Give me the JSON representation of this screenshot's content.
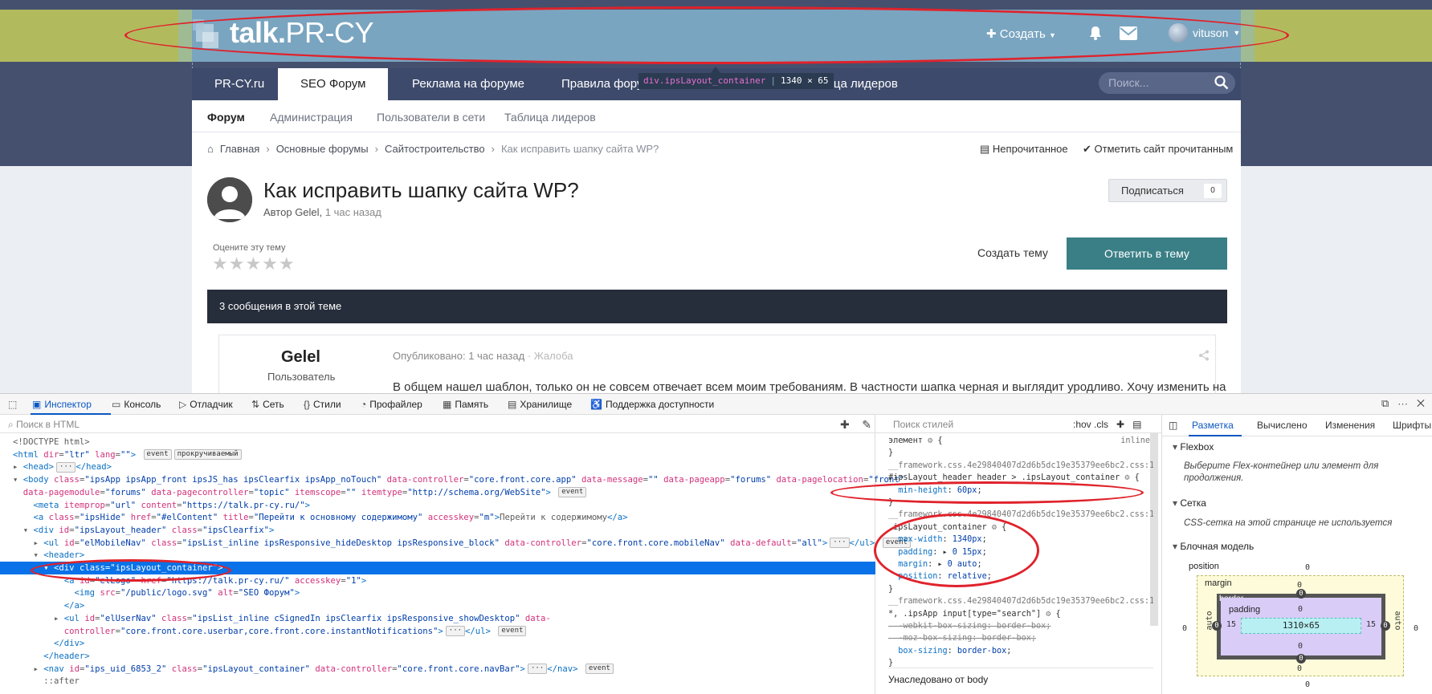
{
  "site": {
    "logo_bold": "talk.",
    "logo_light": "PR-CY",
    "create_label": "Создать",
    "username": "vituson",
    "colors": {
      "header": "#7aa5c0",
      "nav": "#3d4a6b",
      "accent": "#3a7f86",
      "overlay": "#b2ba5e"
    }
  },
  "nav": {
    "tabs": [
      "PR-CY.ru",
      "SEO Форум",
      "Реклама на форуме",
      "Правила фору",
      "Таблица лидеров"
    ],
    "search_placeholder": "Поиск...",
    "tooltip_name": "div.ipsLayout_container",
    "tooltip_size": "1340 × 65"
  },
  "subnav": [
    "Форум",
    "Администрация",
    "Пользователи в сети",
    "Таблица лидеров"
  ],
  "breadcrumb": [
    "Главная",
    "Основные форумы",
    "Сайтостроительство",
    "Как исправить шапку сайта WP?"
  ],
  "actions": {
    "unread": "Непрочитанное",
    "mark_read": "Отметить сайт прочитанным"
  },
  "topic": {
    "title": "Как исправить шапку сайта WP?",
    "author_prefix": "Автор",
    "author": "Gelel",
    "time": "1 час назад",
    "subscribe": "Подписаться",
    "subscribe_count": "0",
    "rate_label": "Оцените эту тему",
    "stars": "★★★★★",
    "create_topic": "Создать тему",
    "reply": "Ответить в тему",
    "messages_bar": "3 сообщения в этой теме"
  },
  "post": {
    "author": "Gelel",
    "role": "Пользователь",
    "published": "Опубликовано: 1 час назад",
    "complaint": "Жалоба",
    "text": "В общем нашел шаблон, только он не совсем отвечает всем моим требованиям. В частности шапка черная и выглядит уродливо. Хочу изменить на"
  },
  "devtools": {
    "tabs": [
      "Инспектор",
      "Консоль",
      "Отладчик",
      "Сеть",
      "Стили",
      "Профайлер",
      "Память",
      "Хранилище",
      "Поддержка доступности"
    ],
    "html_search_placeholder": "Поиск в HTML",
    "styles_search_placeholder": "Поиск стилей",
    "styles_tools": ":hov  .cls",
    "inherited": "Унаследовано от body",
    "layout_tabs": [
      "Разметка",
      "Вычислено",
      "Изменения",
      "Шрифты"
    ],
    "flexbox_head": "Flexbox",
    "flexbox_note": "Выберите Flex-контейнер или элемент для продолжения.",
    "grid_head": "Сетка",
    "grid_note": "CSS-сетка на этой странице не используется",
    "boxmodel_head": "Блочная модель",
    "box": {
      "position_label": "position",
      "margin_label": "margin",
      "border_label": "border",
      "padding_label": "padding",
      "content": "1310×65",
      "auto": "auto",
      "zero": "0",
      "fifteen": "15"
    }
  },
  "html_lines": [
    {
      "pre": "",
      "html": "<span>&lt;!DOCTYPE html&gt;</span>"
    },
    {
      "pre": "",
      "html": "<span class='t'>&lt;html</span> <span class='a'>dir</span>=<span class='v'>\"ltr\"</span> <span class='a'>lang</span>=<span class='v'>\"\"</span><span class='t'>&gt;</span> <span class='badge'>event</span><span class='badge'>прокручиваемый</span>"
    },
    {
      "pre": "▸ ",
      "html": "<span class='t'>&lt;head&gt;</span><span class='badge'>···</span><span class='t'>&lt;/head&gt;</span>"
    },
    {
      "pre": "▾ ",
      "html": "<span class='t'>&lt;body</span> <span class='a'>class</span>=<span class='v'>\"ipsApp ipsApp_front ipsJS_has ipsClearfix ipsApp_noTouch\"</span> <span class='a'>data-controller</span>=<span class='v'>\"core.front.core.app\"</span> <span class='a'>data-message</span>=<span class='v'>\"\"</span> <span class='a'>data-pageapp</span>=<span class='v'>\"forums\"</span> <span class='a'>data-pagelocation</span>=<span class='v'>\"front\"</span>"
    },
    {
      "pre": "  ",
      "html": "<span class='a'>data-pagemodule</span>=<span class='v'>\"forums\"</span> <span class='a'>data-pagecontroller</span>=<span class='v'>\"topic\"</span> <span class='a'>itemscope</span>=<span class='v'>\"\"</span> <span class='a'>itemtype</span>=<span class='v'>\"http://schema.org/WebSite\"</span><span class='t'>&gt;</span> <span class='badge'>event</span>"
    },
    {
      "pre": "    ",
      "html": "<span class='t'>&lt;meta</span> <span class='a'>itemprop</span>=<span class='v'>\"url\"</span> <span class='a'>content</span>=<span class='v'>\"https://talk.pr-cy.ru/\"</span><span class='t'>&gt;</span>"
    },
    {
      "pre": "    ",
      "html": "<span class='t'>&lt;a</span> <span class='a'>class</span>=<span class='v'>\"ipsHide\"</span> <span class='a'>href</span>=<span class='v'>\"#elContent\"</span> <span class='a'>title</span>=<span class='v'>\"Перейти к основному содержимому\"</span> <span class='a'>accesskey</span>=<span class='v'>\"m\"</span><span class='t'>&gt;</span>Перейти к содержимому<span class='t'>&lt;/a&gt;</span>"
    },
    {
      "pre": "  ▾ ",
      "html": "<span class='t'>&lt;div</span> <span class='a'>id</span>=<span class='v'>\"ipsLayout_header\"</span> <span class='a'>class</span>=<span class='v'>\"ipsClearfix\"</span><span class='t'>&gt;</span>"
    },
    {
      "pre": "    ▸ ",
      "html": "<span class='t'>&lt;ul</span> <span class='a'>id</span>=<span class='v'>\"elMobileNav\"</span> <span class='a'>class</span>=<span class='v'>\"ipsList_inline ipsResponsive_hideDesktop ipsResponsive_block\"</span> <span class='a'>data-controller</span>=<span class='v'>\"core.front.core.mobileNav\"</span> <span class='a'>data-default</span>=<span class='v'>\"all\"</span><span class='t'>&gt;</span><span class='badge'>···</span><span class='t'>&lt;/ul&gt;</span> <span class='badge'>event</span>"
    },
    {
      "pre": "    ▾ ",
      "html": "<span class='t'>&lt;header&gt;</span>"
    },
    {
      "pre": "      ▾ ",
      "html": "<span class='t'>&lt;div</span> <span class='a'>class</span>=<span class='v'>\"ipsLayout_container\"</span><span class='t'>&gt;</span>",
      "selected": true
    },
    {
      "pre": "          ",
      "html": "<span class='t'>&lt;a</span> <span class='a'>id</span>=<span class='v'>\"elLogo\"</span> <span class='a'>href</span>=<span class='v'>\"https://talk.pr-cy.ru/\"</span> <span class='a'>accesskey</span>=<span class='v'>\"1\"</span><span class='t'>&gt;</span>"
    },
    {
      "pre": "            ",
      "html": "<span class='t'>&lt;img</span> <span class='a'>src</span>=<span class='v'>\"/public/logo.svg\"</span> <span class='a'>alt</span>=<span class='v'>\"SEO Форум\"</span><span class='t'>&gt;</span>"
    },
    {
      "pre": "          ",
      "html": "<span class='t'>&lt;/a&gt;</span>"
    },
    {
      "pre": "        ▸ ",
      "html": "<span class='t'>&lt;ul</span> <span class='a'>id</span>=<span class='v'>\"elUserNav\"</span> <span class='a'>class</span>=<span class='v'>\"ipsList_inline cSignedIn ipsClearfix ipsResponsive_showDesktop\"</span> <span class='a'>data-</span>"
    },
    {
      "pre": "          ",
      "html": "<span class='a'>controller</span>=<span class='v'>\"core.front.core.userbar,core.front.core.instantNotifications\"</span><span class='t'>&gt;</span><span class='badge'>···</span><span class='t'>&lt;/ul&gt;</span> <span class='badge'>event</span>"
    },
    {
      "pre": "        ",
      "html": "<span class='t'>&lt;/div&gt;</span>"
    },
    {
      "pre": "      ",
      "html": "<span class='t'>&lt;/header&gt;</span>"
    },
    {
      "pre": "    ▸ ",
      "html": "<span class='t'>&lt;nav</span> <span class='a'>id</span>=<span class='v'>\"ips_uid_6853_2\"</span> <span class='a'>class</span>=<span class='v'>\"ipsLayout_container\"</span> <span class='a'>data-controller</span>=<span class='v'>\"core.front.core.navBar\"</span><span class='t'>&gt;</span><span class='badge'>···</span><span class='t'>&lt;/nav&gt;</span> <span class='badge'>event</span>"
    },
    {
      "pre": "      ",
      "html": "::after"
    }
  ],
  "css_lines": [
    {
      "html": "элемент <span style='color:#777'>⚙</span> {",
      "right": "inline"
    },
    {
      "html": "}"
    },
    {
      "html": "__framework.css.4e29840407d2d6b5dc19e35379ee6bc2.css:1",
      "cls": "src"
    },
    {
      "html": "#ipsLayout_header header &gt; .ipsLayout_container <span style='color:#777'>⚙</span> {",
      "cls": "sel"
    },
    {
      "html": "&nbsp;&nbsp;<span class='p'>min-height</span>: <span class='val'>60px</span>;"
    },
    {
      "html": "}"
    },
    {
      "html": "__framework.css.4e29840407d2d6b5dc19e35379ee6bc2.css:1",
      "cls": "src"
    },
    {
      "html": ".ipsLayout_container <span style='color:#777'>⚙</span> {",
      "cls": "sel"
    },
    {
      "html": "&nbsp;&nbsp;<span class='p'>max-width</span>: <span class='val'>1340px</span>;"
    },
    {
      "html": "&nbsp;&nbsp;<span class='p'>padding</span>: ▸ <span class='val'>0 15px</span>;"
    },
    {
      "html": "&nbsp;&nbsp;<span class='p'>margin</span>: ▸ <span class='val'>0 auto</span>;"
    },
    {
      "html": "&nbsp;&nbsp;<span class='p'>position</span>: <span class='val'>relative</span>;"
    },
    {
      "html": "}"
    },
    {
      "html": "__framework.css.4e29840407d2d6b5dc19e35379ee6bc2.css:1",
      "cls": "src"
    },
    {
      "html": "*, .ipsApp input[type=\"search\"] <span style='color:#777'>⚙</span> {",
      "cls": "sel"
    },
    {
      "html": "&nbsp;&nbsp;-webkit-box-sizing: border-box;",
      "cls": "struck"
    },
    {
      "html": "&nbsp;&nbsp;-moz-box-sizing: border-box;",
      "cls": "struck"
    },
    {
      "html": "&nbsp;&nbsp;<span class='p'>box-sizing</span>: <span class='val'>border-box</span>;"
    },
    {
      "html": "}"
    }
  ]
}
